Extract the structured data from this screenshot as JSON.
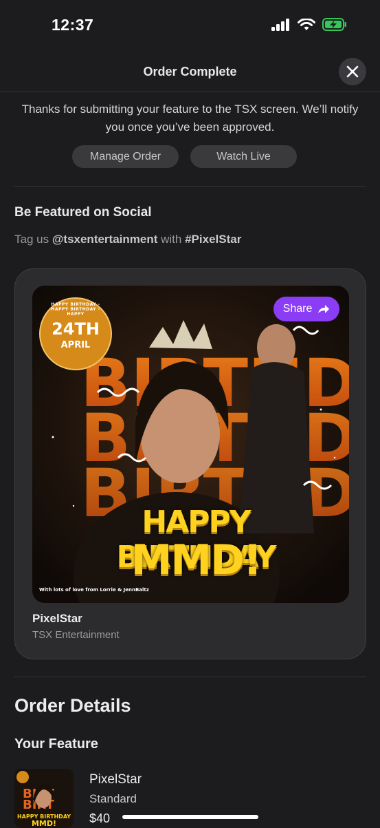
{
  "status_bar": {
    "time": "12:37"
  },
  "header": {
    "title": "Order Complete"
  },
  "confirmation": {
    "message": "Thanks for submitting your feature to the TSX screen. We’ll notify you once you’ve been approved.",
    "manage_label": "Manage Order",
    "watch_label": "Watch Live"
  },
  "social": {
    "title": "Be Featured on Social",
    "tag_prefix": "Tag us",
    "handle": "@tsxentertainment",
    "tag_with": "with",
    "hashtag": "#PixelStar"
  },
  "feature_card": {
    "share_label": "Share",
    "name": "PixelStar",
    "owner": "TSX Entertainment",
    "poster": {
      "badge_day": "24TH",
      "badge_month": "APRIL",
      "badge_ring": "HAPPY BIRTHDAY - HAPPY BIRTHDAY - HAPPY",
      "line1": "HAPPY BIRTHDAY",
      "line2": "MMD!",
      "credit": "With lots of love from Lorrie & JennBaltz"
    }
  },
  "order_details": {
    "title": "Order Details",
    "feature_title": "Your Feature",
    "item": {
      "name": "PixelStar",
      "tier": "Standard",
      "price": "$40"
    }
  },
  "colors": {
    "background": "#1c1c1e",
    "card": "#2c2c2e",
    "share": "#8b3df5",
    "poster_yellow": "#ffd21f",
    "poster_orange": "#f07a1a",
    "battery_green": "#34c759"
  }
}
